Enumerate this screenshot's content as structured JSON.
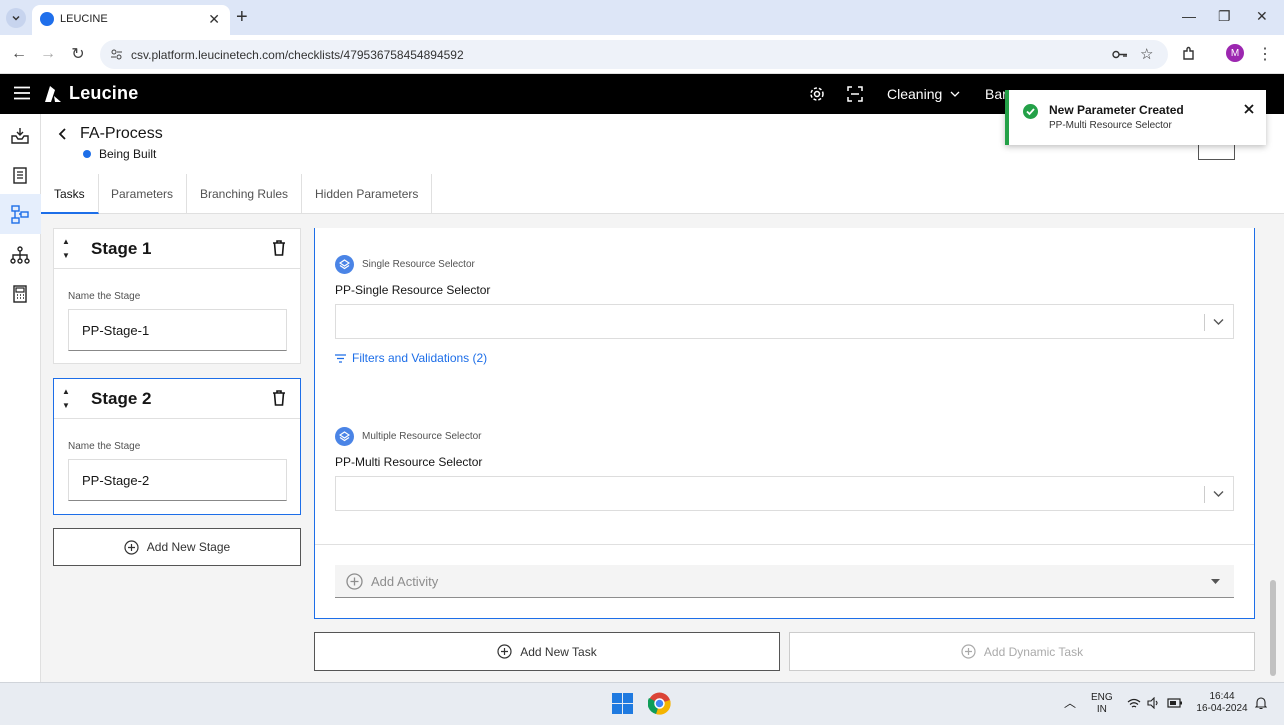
{
  "browser": {
    "tab_title": "LEUCINE",
    "url": "csv.platform.leucinetech.com/checklists/479536758454894592",
    "profile_initial": "M"
  },
  "app": {
    "brand": "Leucine",
    "facility": "Cleaning",
    "header_truncated_1": "Bar"
  },
  "page": {
    "title": "FA-Process",
    "status": "Being Built",
    "tabs": [
      "Tasks",
      "Parameters",
      "Branching Rules",
      "Hidden Parameters"
    ]
  },
  "stages": [
    {
      "name": "Stage 1",
      "field_label": "Name the Stage",
      "value": "PP-Stage-1"
    },
    {
      "name": "Stage 2",
      "field_label": "Name the Stage",
      "value": "PP-Stage-2"
    }
  ],
  "add_stage_label": "Add New Stage",
  "task": {
    "params": [
      {
        "type": "Single Resource Selector",
        "label": "PP-Single Resource Selector"
      },
      {
        "type": "Multiple Resource Selector",
        "label": "PP-Multi Resource Selector"
      }
    ],
    "filters_label": "Filters and Validations (2)",
    "add_activity_label": "Add Activity"
  },
  "buttons": {
    "add_task": "Add New Task",
    "add_dynamic_task": "Add Dynamic Task"
  },
  "toast": {
    "title": "New Parameter Created",
    "subtitle": "PP-Multi Resource Selector"
  },
  "system": {
    "lang_1": "ENG",
    "lang_2": "IN",
    "time": "16:44",
    "date": "16-04-2024"
  },
  "colors": {
    "accent": "#1d6ee8",
    "success": "#24a148",
    "header_bg": "#000000"
  }
}
